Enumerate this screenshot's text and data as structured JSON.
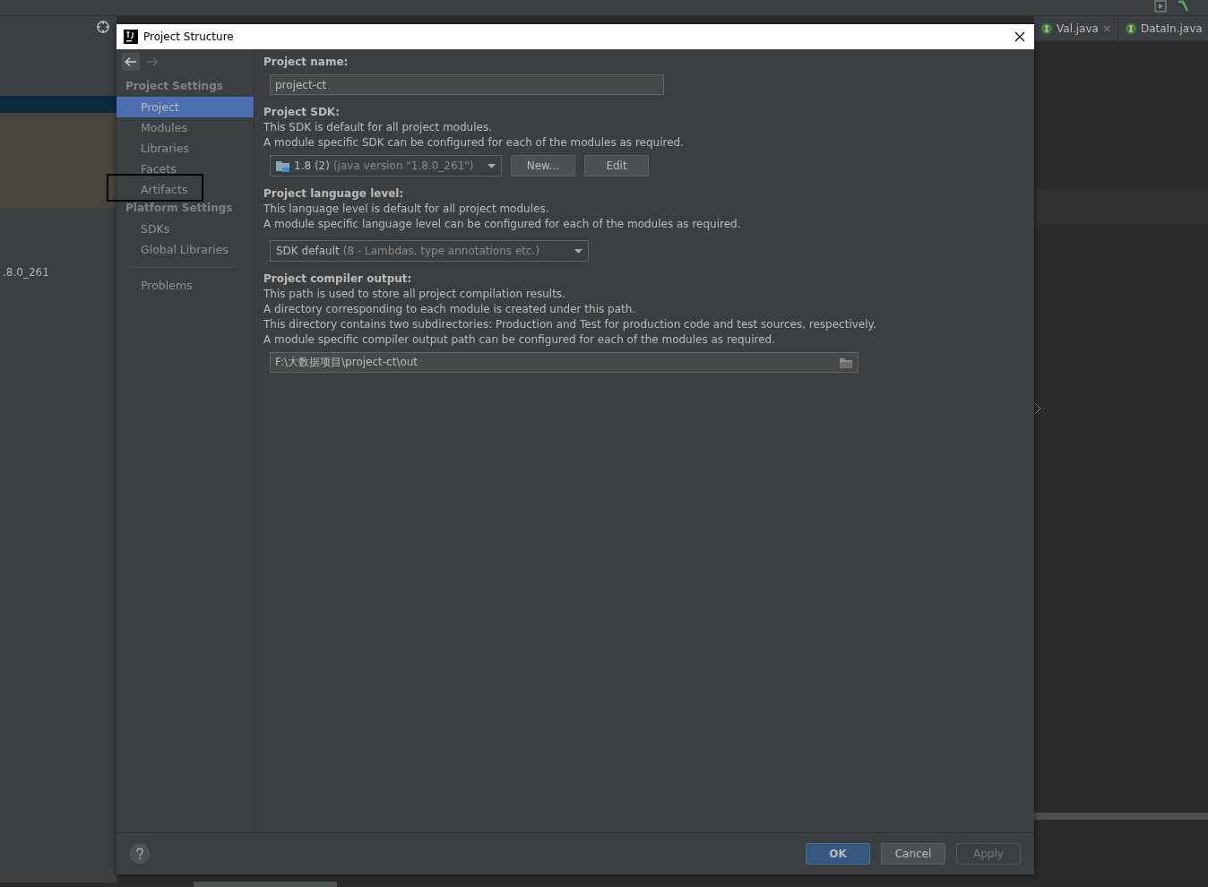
{
  "ide": {
    "side_text": ".8.0_261",
    "editor_tabs": [
      {
        "label": "Val.java",
        "closable": true
      },
      {
        "label": "DataIn.java",
        "closable": false
      }
    ]
  },
  "dialog": {
    "title": "Project Structure",
    "sidebar": {
      "sections": [
        {
          "heading": "Project Settings",
          "items": [
            {
              "label": "Project",
              "selected": true,
              "highlighted": false
            },
            {
              "label": "Modules",
              "selected": false,
              "highlighted": false
            },
            {
              "label": "Libraries",
              "selected": false,
              "highlighted": false
            },
            {
              "label": "Facets",
              "selected": false,
              "highlighted": false
            },
            {
              "label": "Artifacts",
              "selected": false,
              "highlighted": true
            }
          ]
        },
        {
          "heading": "Platform Settings",
          "items": [
            {
              "label": "SDKs",
              "selected": false,
              "highlighted": false
            },
            {
              "label": "Global Libraries",
              "selected": false,
              "highlighted": false
            }
          ]
        }
      ],
      "extra_items": [
        {
          "label": "Problems",
          "selected": false,
          "highlighted": false
        }
      ]
    },
    "sections": [
      {
        "kind": "text_field",
        "heading": "Project name:",
        "value": "project-ct"
      },
      {
        "kind": "sdk",
        "heading": "Project SDK:",
        "lines": [
          "This SDK is default for all project modules.",
          "A module specific SDK can be configured for each of the modules as required."
        ],
        "value": "1.8 (2)",
        "detail": "(java version \"1.8.0_261\")",
        "buttons": [
          "New...",
          "Edit"
        ]
      },
      {
        "kind": "combo",
        "heading": "Project language level:",
        "lines": [
          "This language level is default for all project modules.",
          "A module specific language level can be configured for each of the modules as required."
        ],
        "value": "SDK default",
        "detail": "(8 - Lambdas, type annotations etc.)"
      },
      {
        "kind": "path",
        "heading": "Project compiler output:",
        "lines": [
          "This path is used to store all project compilation results.",
          "A directory corresponding to each module is created under this path.",
          "This directory contains two subdirectories: Production and Test for production code and test sources, respectively.",
          "A module specific compiler output path can be configured for each of the modules as required."
        ],
        "value": "F:\\大数据项目\\project-ct\\out"
      }
    ],
    "footer_buttons": [
      {
        "label": "OK",
        "kind": "default",
        "disabled": false
      },
      {
        "label": "Cancel",
        "kind": "normal",
        "disabled": false
      },
      {
        "label": "Apply",
        "kind": "normal",
        "disabled": true
      }
    ]
  }
}
